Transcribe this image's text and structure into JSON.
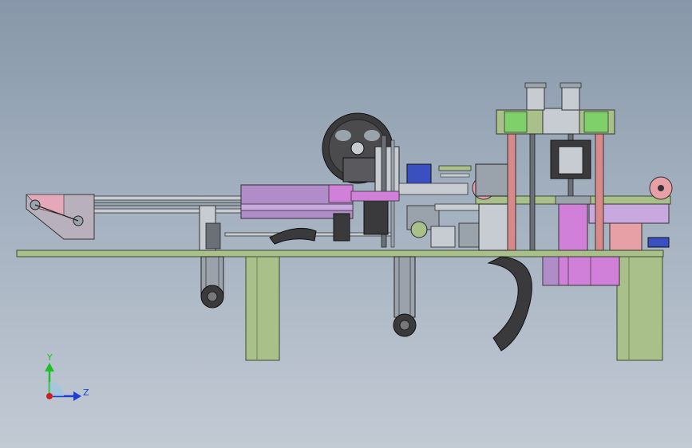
{
  "colors": {
    "background_top": "#8797a9",
    "background_bottom": "#c2cad4",
    "frame_green": "#a9c08a",
    "conveyor_purple": "#b08cc8",
    "part_magenta": "#d080d8",
    "part_pink": "#e7a0a6",
    "motor_dark": "#3a3a3c",
    "steel_grey": "#9aa3ab",
    "rail_grey": "#c7ccd2",
    "accent_blue": "#3a4fc0",
    "axis_y": "#1fbf2a",
    "axis_z": "#1f3fd0",
    "axis_x": "#d01f1f"
  },
  "triad": {
    "y_label": "Y",
    "z_label": "Z"
  }
}
